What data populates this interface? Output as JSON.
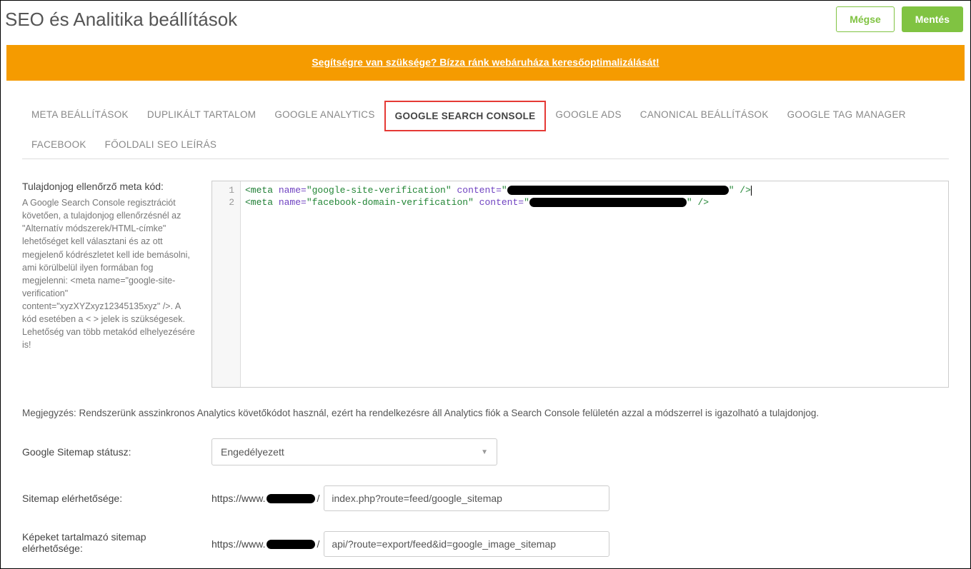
{
  "header": {
    "title": "SEO és Analitika beállítások",
    "cancel_label": "Mégse",
    "save_label": "Mentés"
  },
  "banner": {
    "text": "Segítségre van szüksége? Bízza ránk webáruháza keresőoptimalizálását!"
  },
  "tabs": [
    {
      "label": "META BEÁLLÍTÁSOK",
      "active": false
    },
    {
      "label": "DUPLIKÁLT TARTALOM",
      "active": false
    },
    {
      "label": "GOOGLE ANALYTICS",
      "active": false
    },
    {
      "label": "GOOGLE SEARCH CONSOLE",
      "active": true
    },
    {
      "label": "GOOGLE ADS",
      "active": false
    },
    {
      "label": "CANONICAL BEÁLLÍTÁSOK",
      "active": false
    },
    {
      "label": "GOOGLE TAG MANAGER",
      "active": false
    },
    {
      "label": "FACEBOOK",
      "active": false
    },
    {
      "label": "FŐOLDALI SEO LEÍRÁS",
      "active": false
    }
  ],
  "meta_code": {
    "label": "Tulajdonjog ellenőrző meta kód:",
    "description": "A Google Search Console regisztrációt követően, a tulajdonjog ellenőrzésnél az \"Alternatív módszerek/HTML-címke\" lehetőséget kell választani és az ott megjelenő kódrészletet kell ide bemásolni, ami körülbelül ilyen formában fog megjelenni: <meta name=\"google-site-verification\" content=\"xyzXYZxyz12345135xyz\" />. A kód esetében a < > jelek is szükségesek. Lehetőség van több metakód elhelyezésére is!",
    "line1_prefix": "<meta ",
    "line1_name_attr": "name=",
    "line1_name_val": "\"google-site-verification\"",
    "line1_content_attr": " content=",
    "line1_suffix": "\" />",
    "line2_prefix": "<meta ",
    "line2_name_attr": "name=",
    "line2_name_val": "\"facebook-domain-verification\"",
    "line2_content_attr": " content=",
    "line2_suffix": "\" />",
    "gutter_1": "1",
    "gutter_2": "2"
  },
  "note": "Megjegyzés: Rendszerünk asszinkronos Analytics követőkódot használ, ezért ha rendelkezésre áll Analytics fiók a Search Console felületén azzal a módszerrel is igazolható a tulajdonjog.",
  "sitemap_status": {
    "label": "Google Sitemap státusz:",
    "value": "Engedélyezett"
  },
  "sitemap_url": {
    "label": "Sitemap elérhetősége:",
    "prefix_a": "https://www.",
    "prefix_b": "/",
    "value": "index.php?route=feed/google_sitemap"
  },
  "image_sitemap_url": {
    "label": "Képeket tartalmazó sitemap elérhetősége:",
    "prefix_a": "https://www.",
    "prefix_b": "/",
    "value": "api/?route=export/feed&id=google_image_sitemap"
  }
}
